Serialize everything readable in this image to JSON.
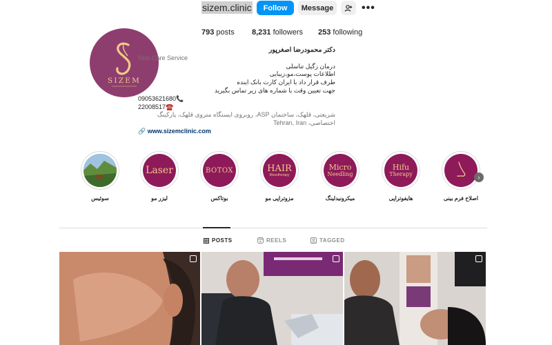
{
  "profile": {
    "username": "sizem.clinic",
    "follow_label": "Follow",
    "message_label": "Message",
    "more_icon": "more-dots-icon",
    "suggest_icon": "person-add-icon",
    "avatar": {
      "brand": "SIZEM",
      "colors": {
        "bg": "#8e3e6e",
        "logo": "#f3c98b"
      }
    }
  },
  "stats": {
    "posts_count": "793",
    "posts_label": "posts",
    "followers_count": "8,231",
    "followers_label": "followers",
    "following_count": "253",
    "following_label": "following"
  },
  "bio": {
    "name": "دکتر محمودرضا اصغرپور",
    "category": "Skin Care Service",
    "lines": [
      "درمان زگیل تناسلی",
      "اطلاعات پوست،مو،زیبایی",
      "طرف قرار داد با ایران کارت بانک اینده",
      "جهت تعیین وقت با شماره های زیر تماس بگیرید",
      "09053621680📞",
      "22008517☎️"
    ],
    "address": "شریعتی، قلهک، ساختمان ASP، روبروی ایستگاه متروی قلهک، پارکینگ اختصاصی، Tehran, Iran",
    "link": "www.sizemclinic.com"
  },
  "highlights": [
    {
      "label": "اصلاح فرم بینی",
      "art": "nose"
    },
    {
      "label": "هایفوتراپی",
      "line1": "Hifu",
      "line2": "Therapy"
    },
    {
      "label": "میکرونیدلینگ",
      "line1": "Micro",
      "line2": "Needling"
    },
    {
      "label": "مزوتراپی مو",
      "line1": "HAIR",
      "line2": "Mesotherapy"
    },
    {
      "label": "بوتاکس",
      "line1": "BOTOX"
    },
    {
      "label": "لیزر مو",
      "line1": "Laser"
    },
    {
      "label": "سوئیس",
      "art": "landscape"
    }
  ],
  "tabs": [
    {
      "label": "POSTS",
      "icon": "grid-icon",
      "active": true
    },
    {
      "label": "REELS",
      "icon": "reels-icon",
      "active": false
    },
    {
      "label": "TAGGED",
      "icon": "tagged-icon",
      "active": false
    }
  ],
  "colors": {
    "accent": "#0095f6",
    "highlight_bg": "#8e1a5a",
    "highlight_text": "#f3c98b"
  }
}
